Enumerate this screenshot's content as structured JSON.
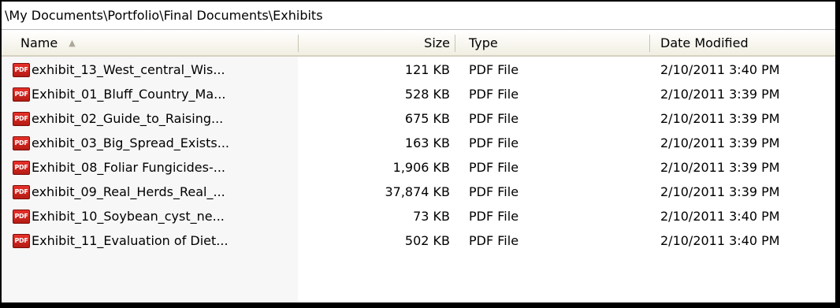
{
  "address_path": "\\My Documents\\Portfolio\\Final Documents\\Exhibits",
  "columns": {
    "name": "Name",
    "size": "Size",
    "type": "Type",
    "date": "Date Modified"
  },
  "sort": {
    "column": "Name",
    "icon": "sort-ascending-icon"
  },
  "file_icon": {
    "name": "pdf-file-icon",
    "label": "PDF",
    "color": "#d42b1f"
  },
  "files": [
    {
      "name": "exhibit_13_West_central_Wis...",
      "size": "121 KB",
      "type": "PDF File",
      "date": "2/10/2011 3:40 PM"
    },
    {
      "name": "Exhibit_01_Bluff_Country_Ma...",
      "size": "528 KB",
      "type": "PDF File",
      "date": "2/10/2011 3:39 PM"
    },
    {
      "name": "exhibit_02_Guide_to_Raising...",
      "size": "675 KB",
      "type": "PDF File",
      "date": "2/10/2011 3:39 PM"
    },
    {
      "name": "exhibit_03_Big_Spread_Exists...",
      "size": "163 KB",
      "type": "PDF File",
      "date": "2/10/2011 3:39 PM"
    },
    {
      "name": "Exhibit_08_Foliar Fungicides-...",
      "size": "1,906 KB",
      "type": "PDF File",
      "date": "2/10/2011 3:39 PM"
    },
    {
      "name": "exhibit_09_Real_Herds_Real_...",
      "size": "37,874 KB",
      "type": "PDF File",
      "date": "2/10/2011 3:39 PM"
    },
    {
      "name": "Exhibit_10_Soybean_cyst_ne...",
      "size": "73 KB",
      "type": "PDF File",
      "date": "2/10/2011 3:40 PM"
    },
    {
      "name": "Exhibit_11_Evaluation of Diet...",
      "size": "502 KB",
      "type": "PDF File",
      "date": "2/10/2011 3:40 PM"
    }
  ]
}
